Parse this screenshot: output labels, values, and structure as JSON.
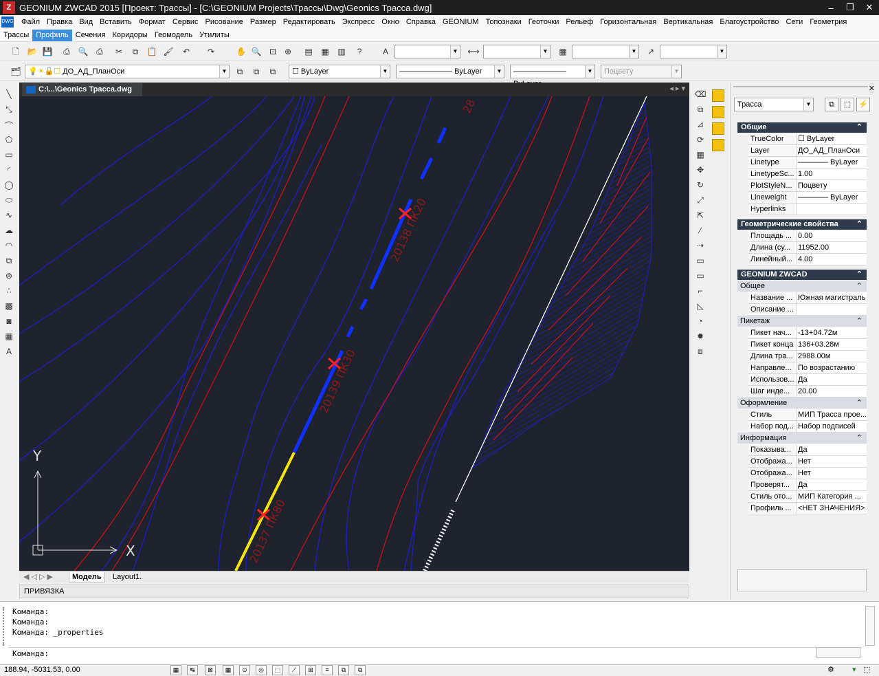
{
  "window": {
    "title": "GEONIUM ZWCAD 2015 [Проект: Трассы] - [C:\\GEONIUM Projects\\Трассы\\Dwg\\Geonics Трасса.dwg]",
    "logo_text": "Z",
    "minimize_glyph": "–",
    "restore_glyph": "❐",
    "close_glyph": "✕"
  },
  "menu": {
    "app_icon_text": "DWG",
    "items": [
      "Файл",
      "Правка",
      "Вид",
      "Вставить",
      "Формат",
      "Сервис",
      "Рисование",
      "Размер",
      "Редактировать",
      "Экспресс",
      "Окно",
      "Справка",
      "GEONIUM",
      "Топознаки",
      "Геоточки",
      "Рельеф",
      "Горизонтальная",
      "Вертикальная",
      "Благоустройство",
      "Сети",
      "Геометрия"
    ],
    "row2": [
      "Трассы",
      "Профиль",
      "Сечения",
      "Коридоры",
      "Геомодель",
      "Утилиты"
    ],
    "row2_active_index": 1
  },
  "toolbar2": {
    "layer_value": "ДО_АД_ПланОси",
    "color_value": "ByLayer",
    "linetype_value": "ByLayer",
    "lineweight_value": "ByLayer",
    "plotstyle_value": "Поцвету"
  },
  "document": {
    "tab_title": "C:\\...\\Geonics Трасса.dwg",
    "tab_nav": "◂ ▸ ▾",
    "layout_tabs": [
      "Модель",
      "Layout1."
    ],
    "layout_nav": "◀ ◁ ▷ ▶"
  },
  "canvas": {
    "background": "#1f232d",
    "contour_color": "#1c1fc6",
    "redline_color": "#c8101a",
    "road_color": "#1030ff",
    "road_yellow": "#f5e60a",
    "axis_x_label": "X",
    "axis_y_label": "Y",
    "pk_labels": [
      "28",
      "20138 ПК20",
      "20139 ПК30",
      "20137 ПК80"
    ]
  },
  "snap_label": "ПРИВЯЗКА",
  "properties": {
    "object_type": "Трасса",
    "groups": {
      "general": "Общие",
      "geometry": "Геометрические свойства",
      "geonium": "GEONIUM ZWCAD",
      "sub_general": "Общее",
      "sub_picket": "Пикетаж",
      "sub_design": "Оформление",
      "sub_info": "Информация"
    },
    "general_rows": [
      {
        "k": "TrueColor",
        "v": "☐ ByLayer"
      },
      {
        "k": "Layer",
        "v": "ДО_АД_ПланОси"
      },
      {
        "k": "Linetype",
        "v": "———— ByLayer"
      },
      {
        "k": "LinetypeSc...",
        "v": "1.00"
      },
      {
        "k": "PlotStyleN...",
        "v": "Поцвету"
      },
      {
        "k": "Lineweight",
        "v": "———— ByLayer"
      },
      {
        "k": "Hyperlinks",
        "v": ""
      }
    ],
    "geometry_rows": [
      {
        "k": "Площадь ...",
        "v": "0.00"
      },
      {
        "k": "Длина (су...",
        "v": "11952.00"
      },
      {
        "k": "Линейный...",
        "v": "4.00"
      }
    ],
    "sub_general_rows": [
      {
        "k": "Название ...",
        "v": "Южная магистраль"
      },
      {
        "k": "Описание ...",
        "v": ""
      }
    ],
    "picket_rows": [
      {
        "k": "Пикет нач...",
        "v": "-13+04.72м"
      },
      {
        "k": "Пикет конца",
        "v": "136+03.28м"
      },
      {
        "k": "Длина тра...",
        "v": "2988.00м"
      },
      {
        "k": "Направле...",
        "v": "По возрастанию"
      },
      {
        "k": "Использов...",
        "v": "Да"
      },
      {
        "k": "Шаг инде...",
        "v": "20.00"
      }
    ],
    "design_rows": [
      {
        "k": "Стиль",
        "v": "МИП Трасса прое..."
      },
      {
        "k": "Набор под...",
        "v": "Набор подписей"
      }
    ],
    "info_rows": [
      {
        "k": "Показыва...",
        "v": "Да"
      },
      {
        "k": "Отобража...",
        "v": "Нет"
      },
      {
        "k": "Отобража...",
        "v": "Нет"
      },
      {
        "k": "Проверят...",
        "v": "Да"
      },
      {
        "k": "Стиль ото...",
        "v": "МИП Категория ..."
      },
      {
        "k": "Профиль ...",
        "v": "<НЕТ ЗНАЧЕНИЯ>"
      }
    ]
  },
  "command": {
    "history": [
      "Команда:",
      "Команда:",
      "Команда:  _properties"
    ],
    "prompt": "Команда:"
  },
  "status": {
    "coords": "188.94, -5031.53, 0.00"
  }
}
